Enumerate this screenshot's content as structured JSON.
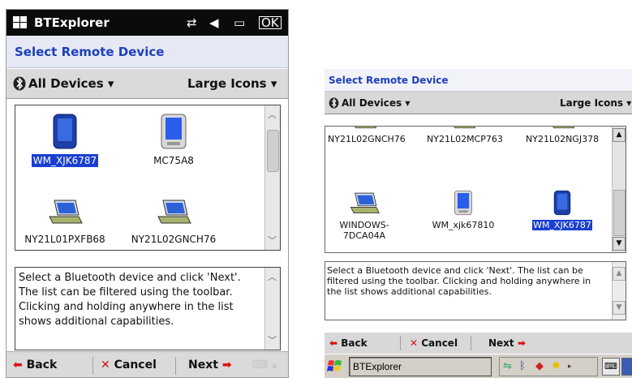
{
  "left": {
    "title_bar": {
      "app_name": "BTExplorer",
      "ok_label": "OK"
    },
    "header": {
      "title": "Select Remote Device"
    },
    "toolbar": {
      "filter_label": "All Devices",
      "view_label": "Large Icons"
    },
    "devices": [
      {
        "name": "WM_XJK6787",
        "type": "phone-dark",
        "selected": true
      },
      {
        "name": "MC75A8",
        "type": "pda",
        "selected": false
      },
      {
        "name": "NY21L01PXFB68",
        "type": "laptop",
        "selected": false
      },
      {
        "name": "NY21L02GNCH76",
        "type": "laptop",
        "selected": false
      }
    ],
    "description": "Select a Bluetooth device and click 'Next'. The list can be filtered using the toolbar. Clicking and holding anywhere in the list shows additional capabilities.",
    "bottom_bar": {
      "back_label": "Back",
      "cancel_label": "Cancel",
      "next_label": "Next"
    }
  },
  "right": {
    "header": {
      "title": "Select Remote Device"
    },
    "toolbar": {
      "filter_label": "All Devices",
      "view_label": "Large Icons"
    },
    "devices": [
      {
        "name": "NY21L02GNCH76",
        "type": "laptop",
        "selected": false
      },
      {
        "name": "NY21L02MCP763",
        "type": "laptop",
        "selected": false
      },
      {
        "name": "NY21L02NGJ378",
        "type": "laptop",
        "selected": false
      },
      {
        "name": "WINDOWS-7DCA04A",
        "type": "laptop",
        "selected": false
      },
      {
        "name": "WM_xjk67810",
        "type": "pda",
        "selected": false
      },
      {
        "name": "WM_XJK6787",
        "type": "phone-dark",
        "selected": true
      }
    ],
    "description": "Select a Bluetooth device and click 'Next'.  The list can be filtered using the toolbar.  Clicking and holding anywhere in the list shows additional capabilities.",
    "bottom_bar": {
      "back_label": "Back",
      "cancel_label": "Cancel",
      "next_label": "Next"
    },
    "taskbar": {
      "task_label": "BTExplorer"
    }
  },
  "colors": {
    "header_blue": "#1d3fbf",
    "selection": "#1a3fd0",
    "arrow_red": "#d11111"
  }
}
